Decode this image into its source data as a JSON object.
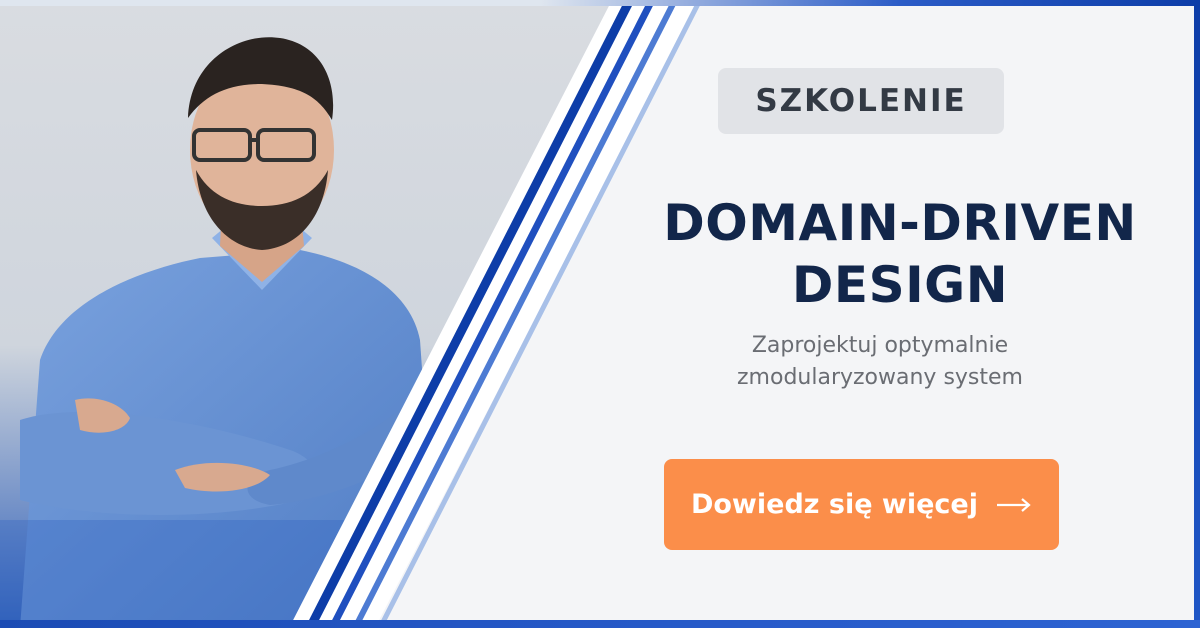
{
  "badge": {
    "label": "SZKOLENIE"
  },
  "title": {
    "line1": "DOMAIN-DRIVEN",
    "line2": "DESIGN"
  },
  "subtitle": {
    "line1": "Zaprojektuj optymalnie",
    "line2": "zmodularyzowany system"
  },
  "cta": {
    "label": "Dowiedz się więcej",
    "icon": "arrow-right-icon"
  },
  "colors": {
    "accent_orange": "#fb8e4a",
    "title_navy": "#12264a",
    "stripe_blue_dark": "#0d3da8",
    "stripe_blue_mid": "#2d63d2",
    "stripe_blue_light": "#a8c0e8",
    "badge_bg": "#e1e3e7",
    "page_bg": "#f4f5f7",
    "shirt_blue": "#6f98d8"
  }
}
